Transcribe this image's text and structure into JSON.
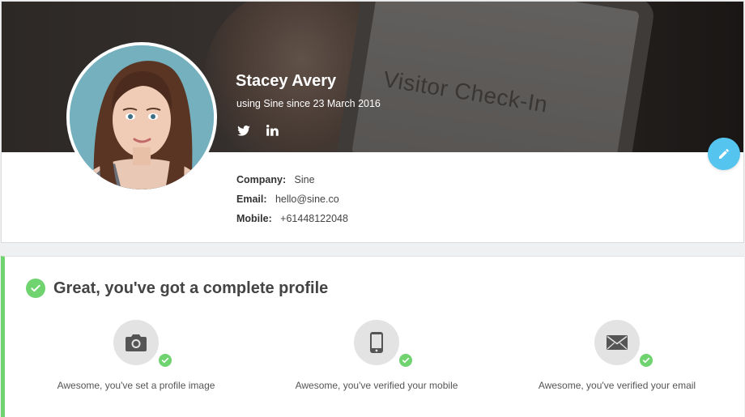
{
  "profile": {
    "name": "Stacey Avery",
    "since": "using Sine since 23 March 2016",
    "banner_text": "Visitor Check-In",
    "social": [
      {
        "icon": "twitter-icon"
      },
      {
        "icon": "linkedin-icon"
      }
    ],
    "details": [
      {
        "label": "Company:",
        "value": "Sine"
      },
      {
        "label": "Email:",
        "value": "hello@sine.co"
      },
      {
        "label": "Mobile:",
        "value": "+61448122048"
      }
    ],
    "edit_icon": "pencil-icon"
  },
  "completion": {
    "title": "Great, you've got a complete profile",
    "items": [
      {
        "icon": "camera-icon",
        "label": "Awesome, you've set a profile image"
      },
      {
        "icon": "mobile-phone-icon",
        "label": "Awesome, you've verified your mobile"
      },
      {
        "icon": "envelope-icon",
        "label": "Awesome, you've verified your email"
      }
    ]
  },
  "colors": {
    "accent_green": "#6fd36f",
    "edit_blue": "#55c4ef"
  }
}
